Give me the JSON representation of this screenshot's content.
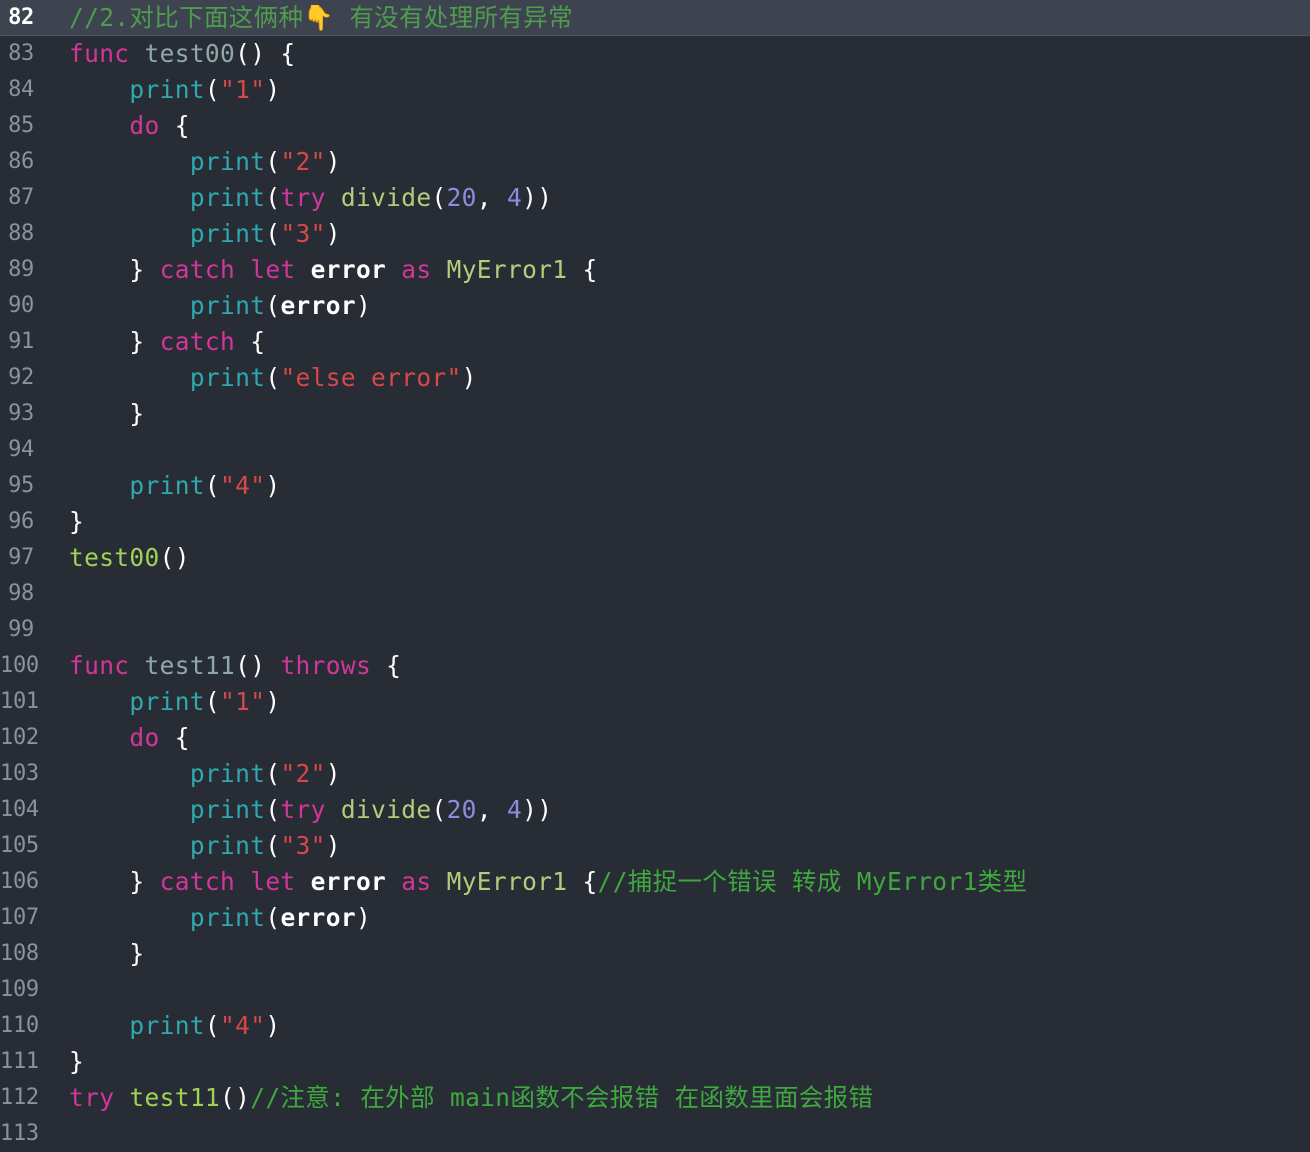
{
  "editor": {
    "theme_colors": {
      "background": "#282c34",
      "active_line_background": "#3e4350",
      "gutter_text": "#8b919e",
      "active_gutter_text": "#ffffff",
      "keyword": "#d1379b",
      "function_name": "#b5cc7a",
      "function_call": "#9fd356",
      "print_builtin": "#2fa8b0",
      "string": "#d6494a",
      "number": "#8c8ce0",
      "punctuation": "#ffffff",
      "identifier": "#ffffff",
      "comment": "#3fa83f",
      "comment_highlighted": "#4f9c4f"
    },
    "language": "Swift",
    "active_line": 82,
    "first_visible_line": 82,
    "last_visible_line": 113,
    "lines": [
      {
        "number": "82",
        "active": true,
        "indent": 0,
        "tokens": [
          {
            "t": "cmt-hl",
            "v": "//2.对比下面这俩种"
          },
          {
            "t": "emoji",
            "v": "👇"
          },
          {
            "t": "cmt-hl",
            "v": " 有没有处理所有异常"
          }
        ]
      },
      {
        "number": "83",
        "active": false,
        "indent": 0,
        "tokens": [
          {
            "t": "kw",
            "v": "func"
          },
          {
            "t": "punct",
            "v": " "
          },
          {
            "t": "fn-decl",
            "v": "test00"
          },
          {
            "t": "punct",
            "v": "() {"
          }
        ]
      },
      {
        "number": "84",
        "active": false,
        "indent": 4,
        "tokens": [
          {
            "t": "print",
            "v": "print"
          },
          {
            "t": "punct",
            "v": "("
          },
          {
            "t": "str",
            "v": "\"1\""
          },
          {
            "t": "punct",
            "v": ")"
          }
        ]
      },
      {
        "number": "85",
        "active": false,
        "indent": 4,
        "tokens": [
          {
            "t": "kw",
            "v": "do"
          },
          {
            "t": "punct",
            "v": " {"
          }
        ]
      },
      {
        "number": "86",
        "active": false,
        "indent": 8,
        "tokens": [
          {
            "t": "print",
            "v": "print"
          },
          {
            "t": "punct",
            "v": "("
          },
          {
            "t": "str",
            "v": "\"2\""
          },
          {
            "t": "punct",
            "v": ")"
          }
        ]
      },
      {
        "number": "87",
        "active": false,
        "indent": 8,
        "tokens": [
          {
            "t": "print",
            "v": "print"
          },
          {
            "t": "punct",
            "v": "("
          },
          {
            "t": "kw",
            "v": "try"
          },
          {
            "t": "punct",
            "v": " "
          },
          {
            "t": "fn",
            "v": "divide"
          },
          {
            "t": "punct",
            "v": "("
          },
          {
            "t": "num",
            "v": "20"
          },
          {
            "t": "punct",
            "v": ", "
          },
          {
            "t": "num",
            "v": "4"
          },
          {
            "t": "punct",
            "v": "))"
          }
        ]
      },
      {
        "number": "88",
        "active": false,
        "indent": 8,
        "tokens": [
          {
            "t": "print",
            "v": "print"
          },
          {
            "t": "punct",
            "v": "("
          },
          {
            "t": "str",
            "v": "\"3\""
          },
          {
            "t": "punct",
            "v": ")"
          }
        ]
      },
      {
        "number": "89",
        "active": false,
        "indent": 4,
        "tokens": [
          {
            "t": "punct",
            "v": "} "
          },
          {
            "t": "kw",
            "v": "catch"
          },
          {
            "t": "punct",
            "v": " "
          },
          {
            "t": "kw",
            "v": "let"
          },
          {
            "t": "punct",
            "v": " "
          },
          {
            "t": "ident",
            "v": "error"
          },
          {
            "t": "punct",
            "v": " "
          },
          {
            "t": "kw",
            "v": "as"
          },
          {
            "t": "punct",
            "v": " "
          },
          {
            "t": "type",
            "v": "MyError1"
          },
          {
            "t": "punct",
            "v": " {"
          }
        ]
      },
      {
        "number": "90",
        "active": false,
        "indent": 8,
        "tokens": [
          {
            "t": "print",
            "v": "print"
          },
          {
            "t": "punct",
            "v": "("
          },
          {
            "t": "ident",
            "v": "error"
          },
          {
            "t": "punct",
            "v": ")"
          }
        ]
      },
      {
        "number": "91",
        "active": false,
        "indent": 4,
        "tokens": [
          {
            "t": "punct",
            "v": "} "
          },
          {
            "t": "kw",
            "v": "catch"
          },
          {
            "t": "punct",
            "v": " {"
          }
        ]
      },
      {
        "number": "92",
        "active": false,
        "indent": 8,
        "tokens": [
          {
            "t": "print",
            "v": "print"
          },
          {
            "t": "punct",
            "v": "("
          },
          {
            "t": "str",
            "v": "\"else error\""
          },
          {
            "t": "punct",
            "v": ")"
          }
        ]
      },
      {
        "number": "93",
        "active": false,
        "indent": 4,
        "tokens": [
          {
            "t": "punct",
            "v": "}"
          }
        ]
      },
      {
        "number": "94",
        "active": false,
        "indent": 0,
        "tokens": []
      },
      {
        "number": "95",
        "active": false,
        "indent": 4,
        "tokens": [
          {
            "t": "print",
            "v": "print"
          },
          {
            "t": "punct",
            "v": "("
          },
          {
            "t": "str",
            "v": "\"4\""
          },
          {
            "t": "punct",
            "v": ")"
          }
        ]
      },
      {
        "number": "96",
        "active": false,
        "indent": 0,
        "tokens": [
          {
            "t": "punct",
            "v": "}"
          }
        ]
      },
      {
        "number": "97",
        "active": false,
        "indent": 0,
        "tokens": [
          {
            "t": "call",
            "v": "test00"
          },
          {
            "t": "punct",
            "v": "()"
          }
        ]
      },
      {
        "number": "98",
        "active": false,
        "indent": 0,
        "tokens": []
      },
      {
        "number": "99",
        "active": false,
        "indent": 0,
        "tokens": []
      },
      {
        "number": "100",
        "active": false,
        "indent": 0,
        "tokens": [
          {
            "t": "kw",
            "v": "func"
          },
          {
            "t": "punct",
            "v": " "
          },
          {
            "t": "fn-decl",
            "v": "test11"
          },
          {
            "t": "punct",
            "v": "() "
          },
          {
            "t": "kw",
            "v": "throws"
          },
          {
            "t": "punct",
            "v": " {"
          }
        ]
      },
      {
        "number": "101",
        "active": false,
        "indent": 4,
        "tokens": [
          {
            "t": "print",
            "v": "print"
          },
          {
            "t": "punct",
            "v": "("
          },
          {
            "t": "str",
            "v": "\"1\""
          },
          {
            "t": "punct",
            "v": ")"
          }
        ]
      },
      {
        "number": "102",
        "active": false,
        "indent": 4,
        "tokens": [
          {
            "t": "kw",
            "v": "do"
          },
          {
            "t": "punct",
            "v": " {"
          }
        ]
      },
      {
        "number": "103",
        "active": false,
        "indent": 8,
        "tokens": [
          {
            "t": "print",
            "v": "print"
          },
          {
            "t": "punct",
            "v": "("
          },
          {
            "t": "str",
            "v": "\"2\""
          },
          {
            "t": "punct",
            "v": ")"
          }
        ]
      },
      {
        "number": "104",
        "active": false,
        "indent": 8,
        "tokens": [
          {
            "t": "print",
            "v": "print"
          },
          {
            "t": "punct",
            "v": "("
          },
          {
            "t": "kw",
            "v": "try"
          },
          {
            "t": "punct",
            "v": " "
          },
          {
            "t": "fn",
            "v": "divide"
          },
          {
            "t": "punct",
            "v": "("
          },
          {
            "t": "num",
            "v": "20"
          },
          {
            "t": "punct",
            "v": ", "
          },
          {
            "t": "num",
            "v": "4"
          },
          {
            "t": "punct",
            "v": "))"
          }
        ]
      },
      {
        "number": "105",
        "active": false,
        "indent": 8,
        "tokens": [
          {
            "t": "print",
            "v": "print"
          },
          {
            "t": "punct",
            "v": "("
          },
          {
            "t": "str",
            "v": "\"3\""
          },
          {
            "t": "punct",
            "v": ")"
          }
        ]
      },
      {
        "number": "106",
        "active": false,
        "indent": 4,
        "tokens": [
          {
            "t": "punct",
            "v": "} "
          },
          {
            "t": "kw",
            "v": "catch"
          },
          {
            "t": "punct",
            "v": " "
          },
          {
            "t": "kw",
            "v": "let"
          },
          {
            "t": "punct",
            "v": " "
          },
          {
            "t": "ident",
            "v": "error"
          },
          {
            "t": "punct",
            "v": " "
          },
          {
            "t": "kw",
            "v": "as"
          },
          {
            "t": "punct",
            "v": " "
          },
          {
            "t": "type",
            "v": "MyError1"
          },
          {
            "t": "punct",
            "v": " {"
          },
          {
            "t": "cmt",
            "v": "//捕捉一个错误 转成 MyError1类型"
          }
        ]
      },
      {
        "number": "107",
        "active": false,
        "indent": 8,
        "tokens": [
          {
            "t": "print",
            "v": "print"
          },
          {
            "t": "punct",
            "v": "("
          },
          {
            "t": "ident",
            "v": "error"
          },
          {
            "t": "punct",
            "v": ")"
          }
        ]
      },
      {
        "number": "108",
        "active": false,
        "indent": 4,
        "tokens": [
          {
            "t": "punct",
            "v": "}"
          }
        ]
      },
      {
        "number": "109",
        "active": false,
        "indent": 0,
        "tokens": []
      },
      {
        "number": "110",
        "active": false,
        "indent": 4,
        "tokens": [
          {
            "t": "print",
            "v": "print"
          },
          {
            "t": "punct",
            "v": "("
          },
          {
            "t": "str",
            "v": "\"4\""
          },
          {
            "t": "punct",
            "v": ")"
          }
        ]
      },
      {
        "number": "111",
        "active": false,
        "indent": 0,
        "tokens": [
          {
            "t": "punct",
            "v": "}"
          }
        ]
      },
      {
        "number": "112",
        "active": false,
        "indent": 0,
        "tokens": [
          {
            "t": "kw",
            "v": "try"
          },
          {
            "t": "punct",
            "v": " "
          },
          {
            "t": "call",
            "v": "test11"
          },
          {
            "t": "punct",
            "v": "()"
          },
          {
            "t": "cmt",
            "v": "//注意: 在外部 main函数不会报错 在函数里面会报错"
          }
        ]
      },
      {
        "number": "113",
        "active": false,
        "indent": 0,
        "tokens": []
      }
    ]
  }
}
